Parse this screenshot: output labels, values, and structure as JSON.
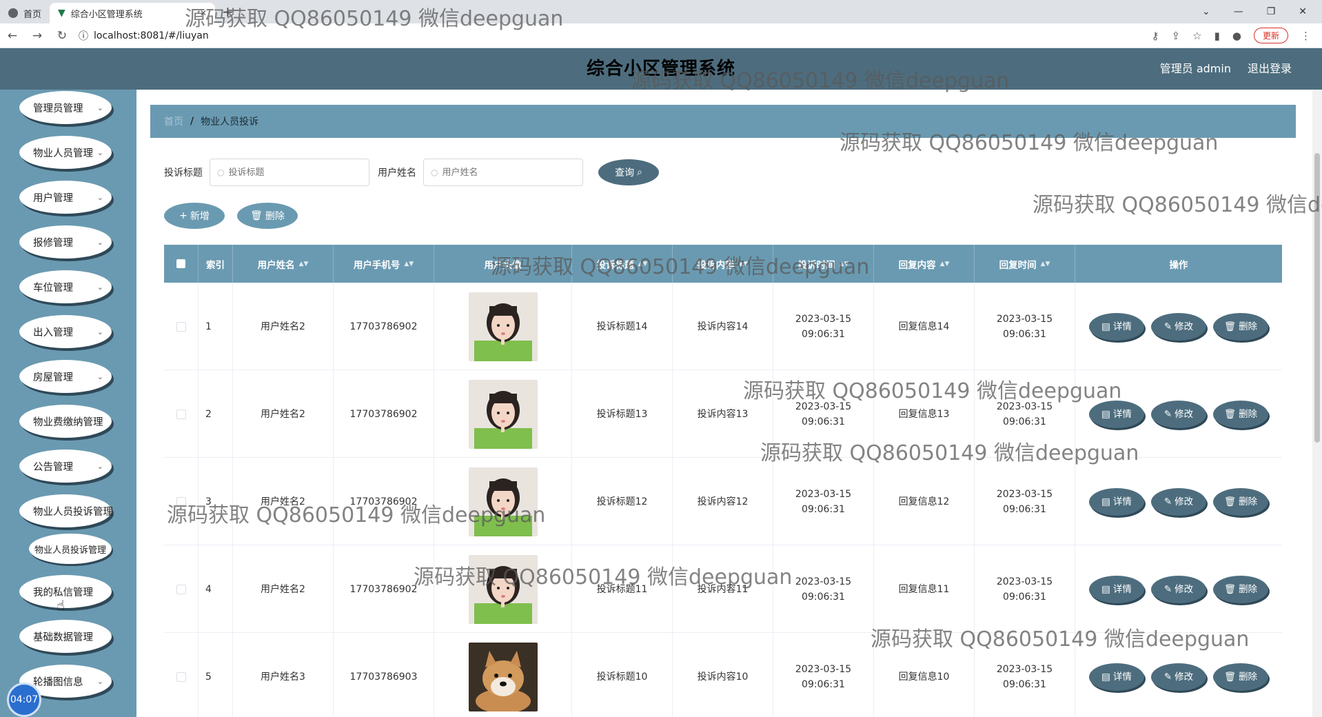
{
  "browser": {
    "tabs": [
      {
        "label": "首页",
        "active": false
      },
      {
        "label": "综合小区管理系统",
        "active": true
      }
    ],
    "url": "localhost:8081/#/liuyan",
    "update_label": "更新"
  },
  "app": {
    "title": "综合小区管理系统",
    "user_label": "管理员 admin",
    "logout_label": "退出登录"
  },
  "sidebar": {
    "items": [
      {
        "label": "管理员管理"
      },
      {
        "label": "物业人员管理"
      },
      {
        "label": "用户管理"
      },
      {
        "label": "报修管理"
      },
      {
        "label": "车位管理"
      },
      {
        "label": "出入管理"
      },
      {
        "label": "房屋管理"
      },
      {
        "label": "物业费缴纳管理"
      },
      {
        "label": "公告管理"
      },
      {
        "label": "物业人员投诉管理"
      },
      {
        "label": "我的私信管理"
      },
      {
        "label": "基础数据管理"
      },
      {
        "label": "轮播图信息"
      }
    ],
    "sub_item": "物业人员投诉管理"
  },
  "breadcrumb": {
    "home": "首页",
    "current": "物业人员投诉"
  },
  "search": {
    "title_label": "投诉标题",
    "title_placeholder": "投诉标题",
    "user_label": "用户姓名",
    "user_placeholder": "用户姓名",
    "query_label": "查询"
  },
  "actions": {
    "add_label": "新增",
    "delete_label": "删除"
  },
  "table": {
    "headers": [
      "索引",
      "用户姓名",
      "用户手机号",
      "用户头像",
      "投诉标题",
      "投诉内容",
      "投诉时间",
      "回复内容",
      "回复时间",
      "操作"
    ],
    "rows": [
      {
        "index": "1",
        "name": "用户姓名2",
        "phone": "17703786902",
        "avatar": "girl",
        "title": "投诉标题14",
        "content": "投诉内容14",
        "time": "2023-03-15 09:06:31",
        "reply": "回复信息14",
        "reply_time": "2023-03-15 09:06:31"
      },
      {
        "index": "2",
        "name": "用户姓名2",
        "phone": "17703786902",
        "avatar": "girl",
        "title": "投诉标题13",
        "content": "投诉内容13",
        "time": "2023-03-15 09:06:31",
        "reply": "回复信息13",
        "reply_time": "2023-03-15 09:06:31"
      },
      {
        "index": "3",
        "name": "用户姓名2",
        "phone": "17703786902",
        "avatar": "girl",
        "title": "投诉标题12",
        "content": "投诉内容12",
        "time": "2023-03-15 09:06:31",
        "reply": "回复信息12",
        "reply_time": "2023-03-15 09:06:31"
      },
      {
        "index": "4",
        "name": "用户姓名2",
        "phone": "17703786902",
        "avatar": "girl",
        "title": "投诉标题11",
        "content": "投诉内容11",
        "time": "2023-03-15 09:06:31",
        "reply": "回复信息11",
        "reply_time": "2023-03-15 09:06:31"
      },
      {
        "index": "5",
        "name": "用户姓名3",
        "phone": "17703786903",
        "avatar": "dog",
        "title": "投诉标题10",
        "content": "投诉内容10",
        "time": "2023-03-15 09:06:31",
        "reply": "回复信息10",
        "reply_time": "2023-03-15 09:06:31"
      }
    ],
    "op_labels": {
      "detail": "详情",
      "edit": "修改",
      "delete": "删除"
    }
  },
  "recording_time": "04:07",
  "watermark": "源码获取 QQ86050149 微信deepguan",
  "colors": {
    "header": "#4d6d7e",
    "sidebar": "#6a9ab1",
    "button_dark": "#4d6d7e"
  }
}
